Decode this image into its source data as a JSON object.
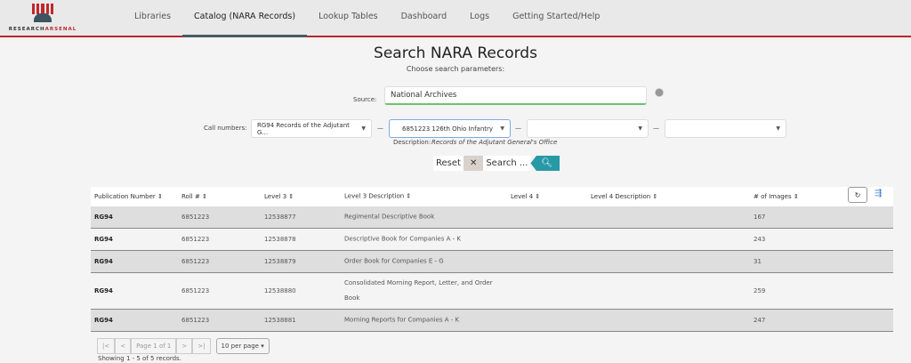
{
  "brand": {
    "name_a": "RESEARCH",
    "name_b": "ARSENAL"
  },
  "nav": [
    {
      "label": "Libraries"
    },
    {
      "label": "Catalog (NARA Records)",
      "active": true
    },
    {
      "label": "Lookup Tables"
    },
    {
      "label": "Dashboard"
    },
    {
      "label": "Logs"
    },
    {
      "label": "Getting Started/Help"
    }
  ],
  "page": {
    "title": "Search NARA Records",
    "subtitle": "Choose search parameters:"
  },
  "form": {
    "source_label": "Source:",
    "source_value": "National Archives",
    "call_label": "Call numbers:",
    "call1": "RG94 Records of the Adjutant G...",
    "call2": "6851223 126th Ohio Infantry",
    "call3": "",
    "call4": "",
    "sep": "—",
    "desc_label": "Description:",
    "desc_value": "Records of the Adjutant General's Office",
    "reset": "Reset",
    "search": "Search ..."
  },
  "table": {
    "headers": [
      "Publication Number ⇕",
      "Roll # ⇕",
      "Level 3 ⇕",
      "Level 3 Description ⇕",
      "Level 4 ⇕",
      "Level 4 Description ⇕",
      "# of Images ⇕"
    ],
    "rows": [
      [
        "RG94",
        "6851223",
        "12538877",
        "Regimental Descriptive Book",
        "",
        "",
        "167"
      ],
      [
        "RG94",
        "6851223",
        "12538878",
        "Descriptive Book for Companies A - K",
        "",
        "",
        "243"
      ],
      [
        "RG94",
        "6851223",
        "12538879",
        "Order Book for Companies E - G",
        "",
        "",
        "31"
      ],
      [
        "RG94",
        "6851223",
        "12538880",
        "Consolidated Morning Report, Letter, and Order Book",
        "",
        "",
        "259"
      ],
      [
        "RG94",
        "6851223",
        "12538881",
        "Morning Reports for Companies A - K",
        "",
        "",
        "247"
      ]
    ]
  },
  "pager": {
    "first": "|<",
    "prev": "<",
    "page": "Page 1 of 1",
    "next": ">",
    "last": ">|",
    "per_page": "10 per page ▾",
    "showing": "Showing 1 - 5 of 5 records."
  },
  "colors": {
    "accent": "#b8252d",
    "search": "#2899a6",
    "source_ok": "#6cc26f"
  }
}
